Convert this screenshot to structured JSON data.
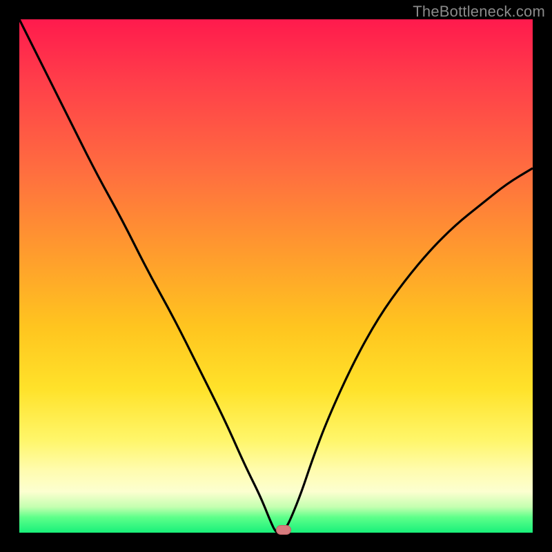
{
  "watermark": "TheBottleneck.com",
  "colors": {
    "background_frame": "#000000",
    "gradient_top": "#ff1a4d",
    "gradient_bottom": "#18f07a",
    "curve_stroke": "#000000",
    "marker_fill": "#d77b7e",
    "marker_stroke": "#c46266"
  },
  "marker": {
    "x_frac": 0.5148,
    "y_frac": 0.995
  },
  "chart_data": {
    "type": "line",
    "title": "",
    "xlabel": "",
    "ylabel": "",
    "xlim": [
      0,
      100
    ],
    "ylim": [
      0,
      100
    ],
    "series": [
      {
        "name": "bottleneck-curve",
        "x": [
          0,
          5,
          10,
          15,
          20,
          25,
          30,
          35,
          40,
          44,
          47,
          49,
          50,
          51,
          52,
          53,
          55,
          57,
          60,
          65,
          70,
          75,
          80,
          85,
          90,
          95,
          100
        ],
        "y": [
          100,
          90,
          80,
          70,
          61,
          51,
          42,
          32,
          22,
          13,
          7,
          2,
          0,
          0,
          1,
          3,
          8,
          14,
          22,
          33,
          42,
          49,
          55,
          60,
          64,
          68,
          71
        ]
      }
    ],
    "annotations": [
      {
        "type": "marker",
        "label": "optimal-point",
        "x": 51,
        "y": 0
      }
    ]
  }
}
